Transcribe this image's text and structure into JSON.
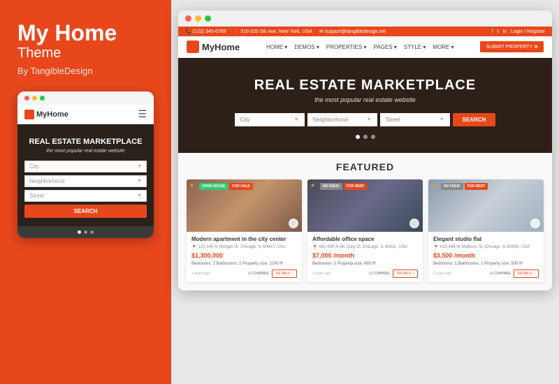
{
  "left_panel": {
    "title": "My Home",
    "subtitle": "Theme",
    "by_line": "By TangibleDesign"
  },
  "mobile": {
    "logo": "MyHome",
    "hero_title": "REAL ESTATE MARKETPLACE",
    "hero_subtitle": "the most popular real estate website",
    "city_placeholder": "City",
    "neighborhood_placeholder": "Neighborhood",
    "street_placeholder": "Street",
    "search_btn": "SEARCH"
  },
  "desktop": {
    "top_bar": {
      "phone1": "(123) 345-6789",
      "address": "516-520 5th Ave, New York, USA",
      "email": "support@tangibledesign.net",
      "login": "Login / Register"
    },
    "nav": {
      "logo": "MyHome",
      "links": [
        "HOME",
        "DEMOS",
        "PROPERTIES",
        "PAGES",
        "STYLE",
        "MORE"
      ],
      "submit_btn": "SUBMIT PROPERTY"
    },
    "hero": {
      "title": "REAL ESTATE MARKETPLACE",
      "subtitle": "the most popular real estate website",
      "city": "City",
      "neighborhood": "Neighborhood",
      "street": "Street",
      "search": "SEARCH"
    },
    "featured": {
      "title": "FEATURED",
      "properties": [
        {
          "title": "Modern apartment in the city center",
          "address": "122-140 N Morgan St, Chicago, IL 60607, USA",
          "price": "$1,300,000",
          "specs": "Bedrooms: 2  Bathrooms: 2  Property size: 1100 ft²",
          "time": "3 years ago",
          "badges": [
            "OPEN HOUSE",
            "FOR SALE"
          ],
          "badge_types": [
            "green",
            "orange"
          ]
        },
        {
          "title": "Affordable office space",
          "address": "661-699 N Mc Cleg Ct, Chicago, IL 60611, USA",
          "price": "$7,000 /month",
          "specs": "Bedrooms: 2  Property size: 680 ft²",
          "time": "3 years ago",
          "badges": [
            "NO FEES!",
            "FOR RENT"
          ],
          "badge_types": [
            "gray",
            "orange"
          ]
        },
        {
          "title": "Elegant studio flat",
          "address": "433-499 W Madison St, Chicago, IL 60606, USA",
          "price": "$3,500 /month",
          "specs": "Bedrooms: 1  Bathrooms: 1  Property size: 500 ft²",
          "time": "3 years ago",
          "badges": [
            "NO FEES!",
            "FOR RENT"
          ],
          "badge_types": [
            "gray",
            "orange"
          ]
        }
      ],
      "compare_label": "COMPARE",
      "details_label": "DETAILS"
    }
  },
  "colors": {
    "orange": "#e8471c",
    "white": "#ffffff",
    "dark": "#333333"
  }
}
